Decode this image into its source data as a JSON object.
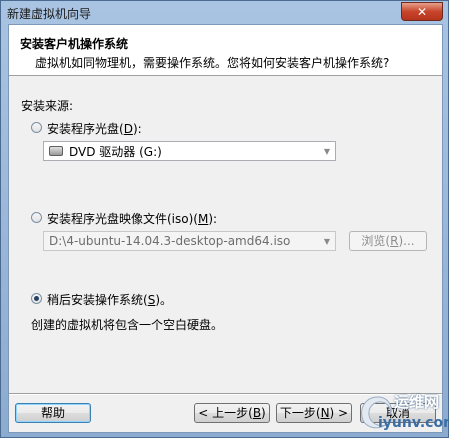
{
  "window": {
    "title": "新建虚拟机向导"
  },
  "header": {
    "title": "安装客户机操作系统",
    "subtitle": "虚拟机如同物理机，需要操作系统。您将如何安装客户机操作系统?"
  },
  "install_source": {
    "label": "安装来源:",
    "options": [
      {
        "label_prefix": "安装程序光盘(",
        "accel": "D",
        "label_suffix": "):",
        "selected": false
      },
      {
        "label_prefix": "安装程序光盘映像文件(iso)(",
        "accel": "M",
        "label_suffix": "):",
        "selected": false
      },
      {
        "label_prefix": "稍后安装操作系统(",
        "accel": "S",
        "label_suffix": ")。",
        "selected": true
      }
    ],
    "disc_drive": {
      "value": "DVD 驱动器 (G:)",
      "icon": "dvd-drive-icon"
    },
    "iso_path": {
      "value": "D:\\4-ubuntu-14.04.3-desktop-amd64.iso"
    },
    "browse_button": {
      "prefix": "浏览(",
      "accel": "R",
      "suffix": ")..."
    },
    "later_description": "创建的虚拟机将包含一个空白硬盘。"
  },
  "footer": {
    "help": "帮助",
    "back": {
      "prefix": "< 上一步(",
      "accel": "B",
      "suffix": ")"
    },
    "next": {
      "prefix": "下一步(",
      "accel": "N",
      "suffix": ") >"
    },
    "cancel": "取消"
  },
  "watermark": {
    "top_text": "运维网",
    "bottom_text": "iyunv.com"
  },
  "colors": {
    "title_bar": "#a9c4e2",
    "close_button": "#c7452b",
    "dialog_background": "#f0f0f0",
    "header_background": "#ffffff",
    "watermark_text": "#3a6ea5"
  }
}
